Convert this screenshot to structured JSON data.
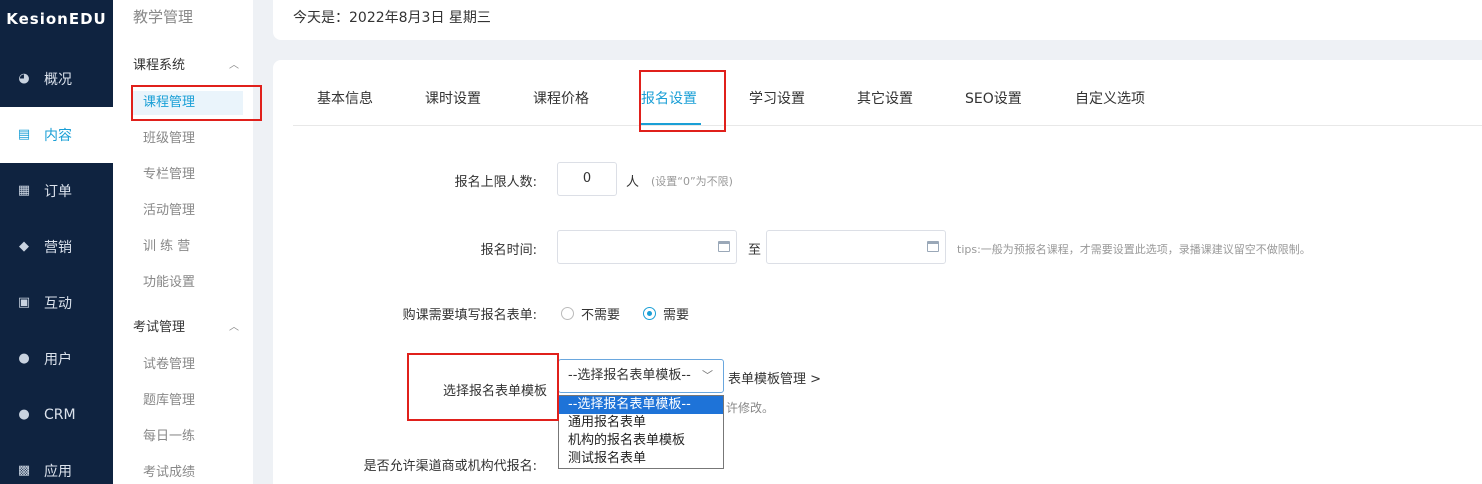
{
  "brand": "KesionEDU",
  "nav": [
    {
      "label": "概况",
      "icon": "dashboard-icon"
    },
    {
      "label": "内容",
      "icon": "document-icon"
    },
    {
      "label": "订单",
      "icon": "order-icon"
    },
    {
      "label": "营销",
      "icon": "tag-icon"
    },
    {
      "label": "互动",
      "icon": "chat-icon"
    },
    {
      "label": "用户",
      "icon": "user-icon"
    },
    {
      "label": "CRM",
      "icon": "crm-icon"
    },
    {
      "label": "应用",
      "icon": "apps-icon"
    }
  ],
  "submenu": {
    "title": "教学管理",
    "group1": "课程系统",
    "group1_items": [
      "课程管理",
      "班级管理",
      "专栏管理",
      "活动管理",
      "训 练 营",
      "功能设置"
    ],
    "group2": "考试管理",
    "group2_items": [
      "试卷管理",
      "题库管理",
      "每日一练",
      "考试成绩"
    ]
  },
  "topbar": {
    "date_text": "今天是：2022年8月3日 星期三"
  },
  "tabs": [
    "基本信息",
    "课时设置",
    "课程价格",
    "报名设置",
    "学习设置",
    "其它设置",
    "SEO设置",
    "自定义选项"
  ],
  "form": {
    "limit_label": "报名上限人数:",
    "limit_value": "0",
    "limit_unit": "人",
    "limit_note": "(设置“0”为不限)",
    "time_label": "报名时间:",
    "time_sep": "至",
    "time_tips": "tips:一般为预报名课程，才需要设置此选项，录播课建议留空不做限制。",
    "need_form_label": "购课需要填写报名表单:",
    "need_no": "不需要",
    "need_yes": "需要",
    "template_label": "选择报名表单模板",
    "template_selected": "--选择报名表单模板--",
    "template_manage": "表单模板管理 >",
    "template_options": [
      "--选择报名表单模板--",
      "通用报名表单",
      "机构的报名表单模板",
      "测试报名表单"
    ],
    "partial_note": "许修改。",
    "channel_label": "是否允许渠道商或机构代报名:"
  }
}
